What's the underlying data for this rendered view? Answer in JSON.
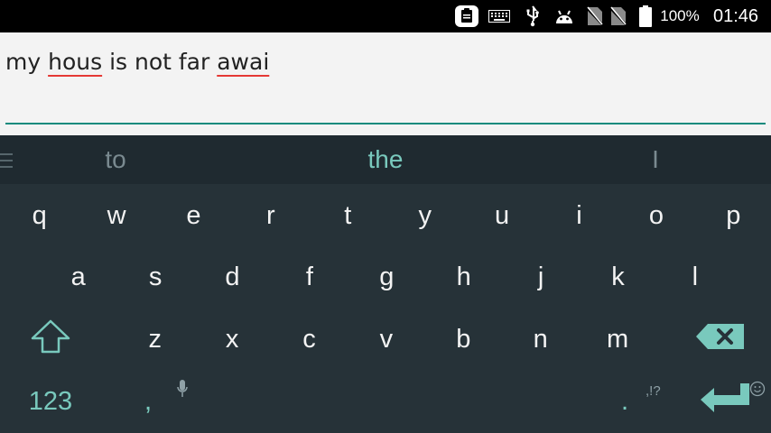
{
  "status_bar": {
    "battery_percent": "100%",
    "clock": "01:46",
    "icons": [
      "clipboard-notification-icon",
      "keyboard-icon",
      "usb-icon",
      "android-debug-icon",
      "no-sim-icon",
      "no-sim-icon",
      "battery-icon"
    ]
  },
  "editor": {
    "words": [
      "my ",
      "hous",
      " is not far ",
      "awai"
    ],
    "underline_color": "#128a7d",
    "misspelling_color": "#e53935"
  },
  "keyboard": {
    "suggestions": {
      "left": "to",
      "center": "the",
      "right": "I"
    },
    "rows": [
      [
        "q",
        "w",
        "e",
        "r",
        "t",
        "y",
        "u",
        "i",
        "o",
        "p"
      ],
      [
        "a",
        "s",
        "d",
        "f",
        "g",
        "h",
        "j",
        "k",
        "l"
      ],
      [
        "z",
        "x",
        "c",
        "v",
        "b",
        "n",
        "m"
      ]
    ],
    "symbols_key": "123",
    "comma_key": ",",
    "period_key": ".",
    "period_hint": ",!?",
    "accent_color": "#79c9bd",
    "background_color": "#263238"
  }
}
